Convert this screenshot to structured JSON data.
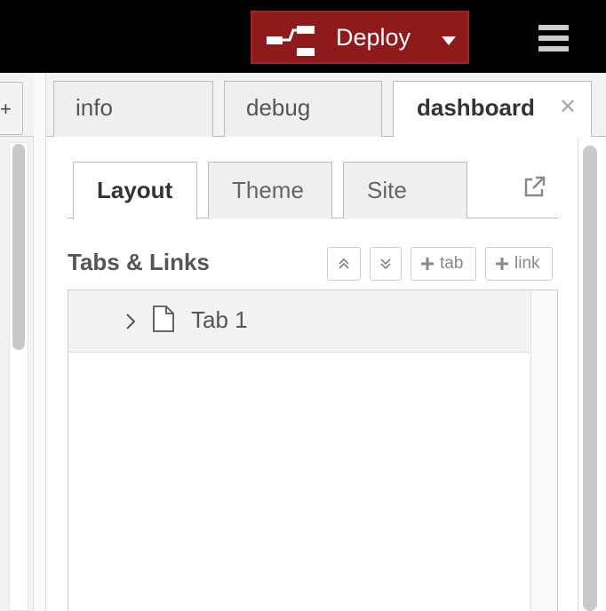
{
  "header": {
    "deploy_label": "Deploy",
    "deploy_icon": "deploy-flow-icon",
    "deploy_color": "#8f1a1c",
    "menu_icon": "hamburger-menu-icon"
  },
  "palette": {
    "add_icon": "plus-icon"
  },
  "sidebar": {
    "tabs": [
      {
        "label": "info"
      },
      {
        "label": "debug"
      },
      {
        "label": "dashboard",
        "active": true
      }
    ],
    "close_icon": "close-icon"
  },
  "dashboard": {
    "tabs": [
      {
        "label": "Layout",
        "active": true
      },
      {
        "label": "Theme"
      },
      {
        "label": "Site"
      }
    ],
    "section_title": "Tabs & Links",
    "toolbar": {
      "expand_all_icon": "double-chevron-up-icon",
      "collapse_all_icon": "double-chevron-down-icon",
      "add_tab_label": "tab",
      "add_link_label": "link"
    },
    "tree": [
      {
        "label": "Tab 1",
        "icon": "document-icon"
      }
    ]
  }
}
